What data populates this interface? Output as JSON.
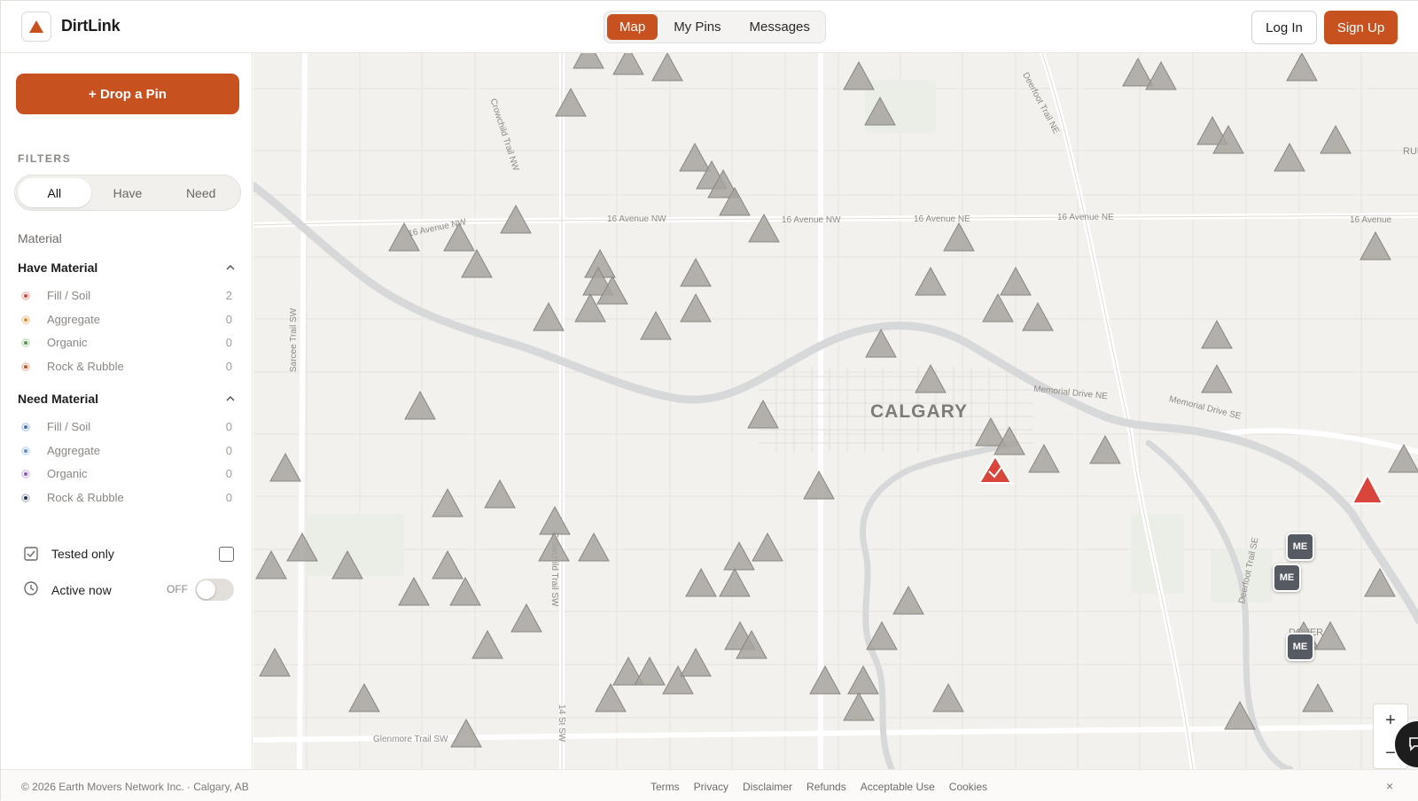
{
  "app": {
    "brand": "DirtLink",
    "accent": "#c85120"
  },
  "nav": {
    "tabs": [
      {
        "label": "Map",
        "active": true
      },
      {
        "label": "My Pins"
      },
      {
        "label": "Messages"
      }
    ]
  },
  "auth": {
    "login": "Log In",
    "signup": "Sign Up"
  },
  "sidebar": {
    "drop_pin": "+ Drop a Pin",
    "filters_title": "FILTERS",
    "segments": [
      {
        "label": "All",
        "active": true
      },
      {
        "label": "Have"
      },
      {
        "label": "Need"
      }
    ],
    "material_label": "Material",
    "have": {
      "title": "Have Material",
      "items": [
        {
          "label": "Fill / Soil",
          "count": "2",
          "color": "#d9453a"
        },
        {
          "label": "Aggregate",
          "count": "0",
          "color": "#e08a2e"
        },
        {
          "label": "Organic",
          "count": "0",
          "color": "#4f9a46"
        },
        {
          "label": "Rock & Rubble",
          "count": "0",
          "color": "#c85120"
        }
      ]
    },
    "need": {
      "title": "Need Material",
      "items": [
        {
          "label": "Fill / Soil",
          "count": "0",
          "color": "#3f6fb5"
        },
        {
          "label": "Aggregate",
          "count": "0",
          "color": "#5b8ad0"
        },
        {
          "label": "Organic",
          "count": "0",
          "color": "#8a57b5"
        },
        {
          "label": "Rock & Rubble",
          "count": "0",
          "color": "#1f2f4a"
        }
      ]
    },
    "tested_only": "Tested only",
    "active_now": "Active now",
    "active_state": "OFF"
  },
  "map": {
    "city_label": "CALGARY",
    "street_labels": [
      "16 Avenue NW",
      "16 Avenue NW",
      "16 Avenue NW",
      "16 Avenue NE",
      "16 Avenue NE",
      "16 Avenue",
      "Crowchild Trail NW",
      "Deerfoot Trail NE",
      "Memorial Drive NE",
      "Memorial Drive SE",
      "Sarcee Trail SW",
      "Crowchild Trail SW",
      "14 St SW",
      "Glenmore Trail SW",
      "Deerfoot Trail SE",
      "DOVER",
      "RUN"
    ],
    "me_badges": [
      "ME",
      "ME",
      "ME"
    ]
  },
  "footer": {
    "copyright": "© 2026 Earth Movers Network Inc. · Calgary, AB",
    "links": [
      "Terms",
      "Privacy",
      "Disclaimer",
      "Refunds",
      "Acceptable Use",
      "Cookies"
    ],
    "close": "×"
  }
}
